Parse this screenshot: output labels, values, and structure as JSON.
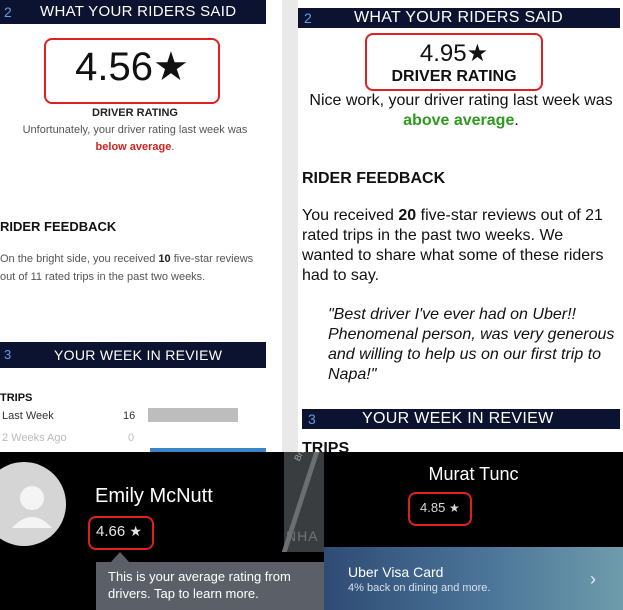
{
  "left_email": {
    "section1": {
      "number": "2",
      "title": "WHAT YOUR RIDERS SAID"
    },
    "rating_value": "4.56★",
    "rating_label": "DRIVER RATING",
    "rating_note": "Unfortunately, your driver rating last week was",
    "rating_status": "below average",
    "rating_status_suffix": ".",
    "feedback_heading": "RIDER FEEDBACK",
    "feedback_text_1": "On the bright side, you received",
    "feedback_count": "10",
    "feedback_text_2": "five-star reviews out of 11 rated trips in the past two weeks.",
    "section2": {
      "number": "3",
      "title": "YOUR WEEK IN REVIEW"
    },
    "trips_heading": "TRIPS",
    "trips": [
      {
        "label": "Last Week",
        "value": "16",
        "fill": 1.0
      },
      {
        "label": "2 Weeks Ago",
        "value": "0",
        "fill": 0.0
      }
    ]
  },
  "right_email": {
    "section1": {
      "number": "2",
      "title": "WHAT YOUR RIDERS SAID"
    },
    "rating_value": "4.95★",
    "rating_label": "DRIVER RATING",
    "rating_note": "Nice work, your driver rating last week was",
    "rating_status": "above average",
    "rating_status_suffix": ".",
    "feedback_heading": "RIDER FEEDBACK",
    "feedback_text_1": "You received",
    "feedback_count": "20",
    "feedback_text_2": "five-star reviews out of 21 rated trips in the past two weeks. We wanted to share what some of these riders had to say.",
    "quote": "\"Best driver I've ever had on Uber!! Phenomenal person, was very generous and willing to help us on our first trip to Napa!\"",
    "section2": {
      "number": "3",
      "title": "YOUR WEEK IN REVIEW"
    },
    "trips_heading": "TRIPS"
  },
  "app_left": {
    "name": "Emily McNutt",
    "rating": "4.66",
    "tooltip": "This is your average rating from drivers. Tap to learn more.",
    "map_labels": [
      "Broadw",
      "NHA"
    ]
  },
  "app_right": {
    "name": "Murat Tunc",
    "rating": "4.85",
    "card_title": "Uber Visa Card",
    "card_subtitle": "4% back on dining and more."
  },
  "colors": {
    "navy": "#0c1330",
    "highlight_red": "#e02020",
    "below_red": "#d0231e",
    "above_green": "#2f9a1f",
    "number_blue": "#5aa0e6"
  },
  "icons": [
    "star-icon",
    "avatar-icon",
    "chevron-right-icon"
  ]
}
